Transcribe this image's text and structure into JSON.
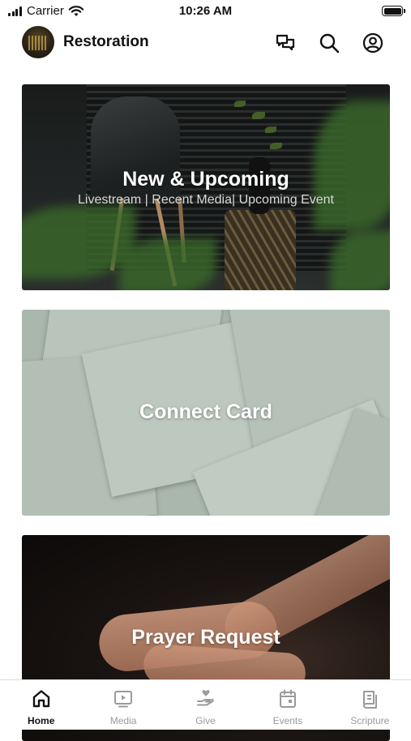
{
  "status_bar": {
    "carrier": "Carrier",
    "time": "10:26 AM"
  },
  "header": {
    "title": "Restoration",
    "icons": [
      "chat-icon",
      "search-icon",
      "profile-icon"
    ]
  },
  "cards": [
    {
      "title": "New & Upcoming",
      "subtitle": "Livestream | Recent Media| Upcoming Event"
    },
    {
      "title": "Connect Card"
    },
    {
      "title": "Prayer Request"
    }
  ],
  "tabs": [
    {
      "label": "Home",
      "icon": "home-icon",
      "active": true
    },
    {
      "label": "Media",
      "icon": "media-icon",
      "active": false
    },
    {
      "label": "Give",
      "icon": "give-icon",
      "active": false
    },
    {
      "label": "Events",
      "icon": "events-icon",
      "active": false
    },
    {
      "label": "Scripture",
      "icon": "scripture-icon",
      "active": false
    }
  ],
  "colors": {
    "active_tab": "#111111",
    "inactive_tab": "#9a9a9a"
  }
}
